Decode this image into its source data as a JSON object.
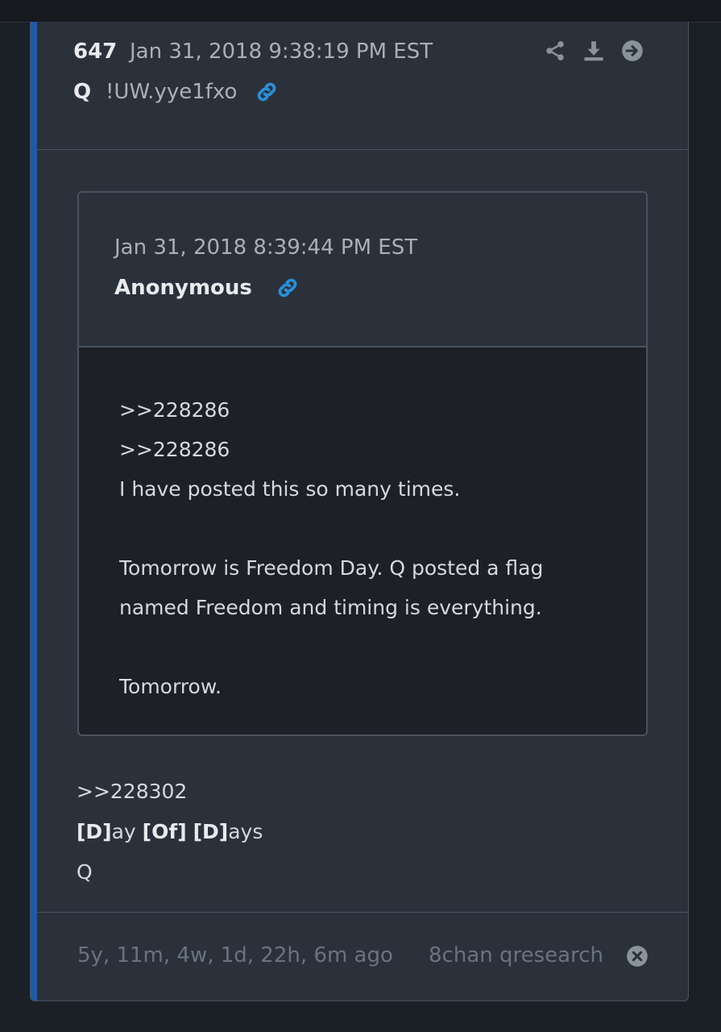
{
  "post": {
    "number": "647",
    "date": "Jan 31, 2018 9:38:19 PM EST",
    "author": "Q",
    "tripcode": "!UW.yye1fxo"
  },
  "header_actions": [
    {
      "icon": "share-icon"
    },
    {
      "icon": "download-icon"
    },
    {
      "icon": "arrow-right-circle-icon"
    }
  ],
  "quote": {
    "date": "Jan 31, 2018 8:39:44 PM EST",
    "author": "Anonymous",
    "lines": [
      ">>228286",
      ">>228286",
      "I have posted this so many times.",
      "",
      "Tomorrow is Freedom Day. Q posted a flag",
      "named Freedom and timing is everything.",
      "",
      "Tomorrow."
    ]
  },
  "body": {
    "ref": ">>228302",
    "line2": {
      "p1": "[D]",
      "p2": "ay ",
      "p3": "[Of]",
      "p4": " ",
      "p5": "[D]",
      "p6": "ays"
    },
    "signature": "Q"
  },
  "footer": {
    "elapsed": "5y, 11m, 4w, 1d, 22h, 6m ago",
    "source": "8chan qresearch"
  },
  "colors": {
    "accent": "#1f5aa6",
    "link": "#2a8fd8",
    "card": "#2b313b",
    "quote_body": "#1d2027"
  }
}
